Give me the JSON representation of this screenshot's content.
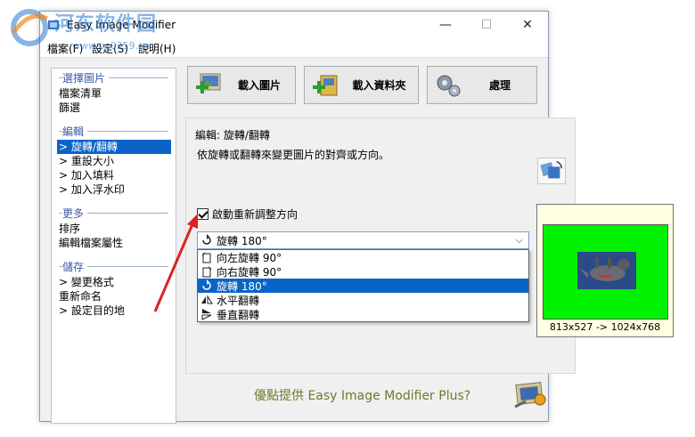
{
  "window": {
    "title": "Easy Image Modifier",
    "controls": {
      "minimize": "—",
      "maximize": "☐",
      "close": "✕"
    }
  },
  "watermark": {
    "text": "河东软件园",
    "url": "www.pc0359.cn"
  },
  "menu": [
    "檔案(F)",
    "設定(S)",
    "說明(H)"
  ],
  "sidebar": {
    "sections": [
      {
        "title": "選擇圖片",
        "items": [
          "檔案清單",
          "篩選"
        ]
      },
      {
        "title": "編輯",
        "items": [
          "旋轉/翻轉",
          "重設大小",
          "加入填料",
          "加入浮水印"
        ]
      },
      {
        "title": "更多",
        "items": [
          "排序",
          "編輯檔案屬性"
        ]
      },
      {
        "title": "儲存",
        "items": [
          "變更格式",
          "重新命名",
          "設定目的地"
        ]
      }
    ],
    "arrow_prefix": ">"
  },
  "toolbar": {
    "load_image": "載入圖片",
    "load_folder": "載入資料夾",
    "process": "處理"
  },
  "panel": {
    "title": "編輯:  旋轉/翻轉",
    "description": "依旋轉或翻轉來變更圖片的對齊或方向。",
    "auto_orient_label": "啟動重新調整方向",
    "selected_option": "旋轉  180°",
    "options": [
      "向左旋轉  90°",
      "向右旋轉  90°",
      "旋轉  180°",
      "水平翻轉",
      "垂直翻轉"
    ]
  },
  "promo": {
    "text": "優點提供 Easy Image Modifier Plus?"
  },
  "preview": {
    "size_text": "813x527 -> 1024x768"
  },
  "colors": {
    "accent": "#0a64c8",
    "preview_bg": "#00f200",
    "arrow": "#e02020"
  }
}
